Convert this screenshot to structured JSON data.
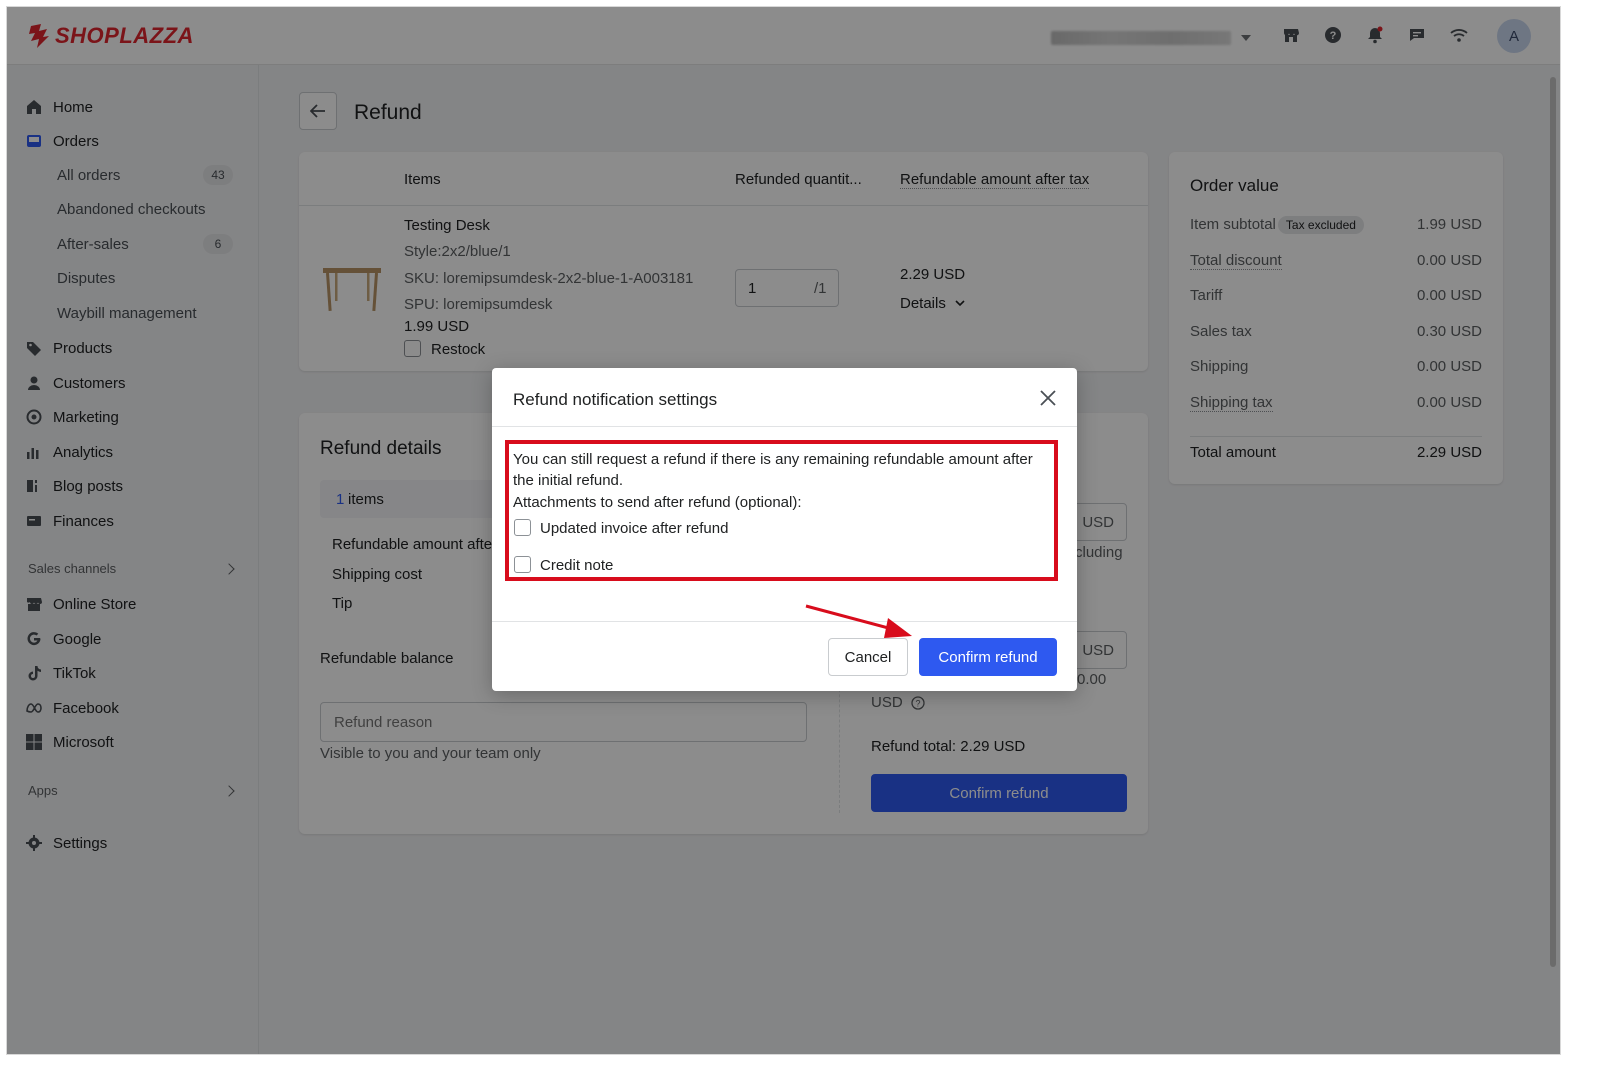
{
  "brand": {
    "name": "SHOPLAZZA",
    "color": "#e0262f"
  },
  "topbar": {
    "icons": [
      "store-icon",
      "help-icon",
      "bell-icon",
      "chat-icon",
      "wifi-icon"
    ],
    "avatar_initial": "A"
  },
  "sidebar": {
    "items": [
      {
        "label": "Home",
        "icon": "home-icon"
      },
      {
        "label": "Orders",
        "icon": "orders-icon"
      },
      {
        "label": "Products",
        "icon": "tag-icon"
      },
      {
        "label": "Customers",
        "icon": "person-icon"
      },
      {
        "label": "Marketing",
        "icon": "marketing-icon"
      },
      {
        "label": "Analytics",
        "icon": "bar-chart-icon"
      },
      {
        "label": "Blog posts",
        "icon": "blog-icon"
      },
      {
        "label": "Finances",
        "icon": "finance-icon"
      }
    ],
    "orders_sub": [
      {
        "label": "All orders",
        "count": "43"
      },
      {
        "label": "Abandoned checkouts",
        "count": ""
      },
      {
        "label": "After-sales",
        "count": "6"
      },
      {
        "label": "Disputes",
        "count": ""
      },
      {
        "label": "Waybill management",
        "count": ""
      }
    ],
    "sales_channels_label": "Sales channels",
    "channels": [
      {
        "label": "Online Store",
        "icon": "store-icon"
      },
      {
        "label": "Google",
        "icon": "google-icon"
      },
      {
        "label": "TikTok",
        "icon": "tiktok-icon"
      },
      {
        "label": "Facebook",
        "icon": "meta-icon"
      },
      {
        "label": "Microsoft",
        "icon": "microsoft-icon"
      }
    ],
    "apps_label": "Apps",
    "settings_label": "Settings"
  },
  "page": {
    "title": "Refund"
  },
  "items_table": {
    "headers": {
      "items": "Items",
      "qty": "Refunded quantit...",
      "amount": "Refundable amount after tax"
    },
    "product": {
      "name": "Testing Desk",
      "style": "Style:2x2/blue/1",
      "sku": "SKU: loremipsumdesk-2x2-blue-1-A003181",
      "spu": "SPU: loremipsumdesk",
      "price": "1.99 USD",
      "restock_label": "Restock",
      "qty_value": "1",
      "qty_max": "/1",
      "refundable_amount": "2.29 USD",
      "details_label": "Details"
    }
  },
  "refund_details": {
    "title": "Refund details",
    "items_count": "1",
    "items_label": "items",
    "refundable_amount_label": "Refundable amount after",
    "shipping_cost_label": "Shipping cost",
    "tip_label": "Tip",
    "refundable_balance_label": "Refundable balance",
    "reason_placeholder": "Refund reason",
    "reason_hint": "Visible to you and your team only",
    "usd_suffix_1": "USD",
    "including_text": "cluding",
    "usd_suffix_2": "USD",
    "zero_text": "0.00",
    "usd_text": "USD",
    "refund_total": "Refund total: 2.29 USD",
    "confirm_label": "Confirm refund"
  },
  "order_value": {
    "title": "Order value",
    "rows": [
      {
        "label": "Item subtotal",
        "tag": "Tax excluded",
        "value": "1.99 USD"
      },
      {
        "label": "Total discount",
        "tag": "",
        "value": "0.00 USD"
      },
      {
        "label": "Tariff",
        "tag": "",
        "value": "0.00 USD"
      },
      {
        "label": "Sales tax",
        "tag": "",
        "value": "0.30 USD"
      },
      {
        "label": "Shipping",
        "tag": "",
        "value": "0.00 USD"
      },
      {
        "label": "Shipping tax",
        "tag": "",
        "value": "0.00 USD"
      }
    ],
    "total_label": "Total amount",
    "total_value": "2.29 USD"
  },
  "modal": {
    "title": "Refund notification settings",
    "notice_line1": "You can still request a refund if there is any remaining refundable amount after",
    "notice_line2": "the initial refund.",
    "attachments_label": "Attachments to send after refund (optional):",
    "option1": "Updated invoice after refund",
    "option2": "Credit note",
    "cancel_label": "Cancel",
    "confirm_label": "Confirm refund",
    "highlight_color": "#d80c1c",
    "primary_color": "#2e59f0"
  }
}
